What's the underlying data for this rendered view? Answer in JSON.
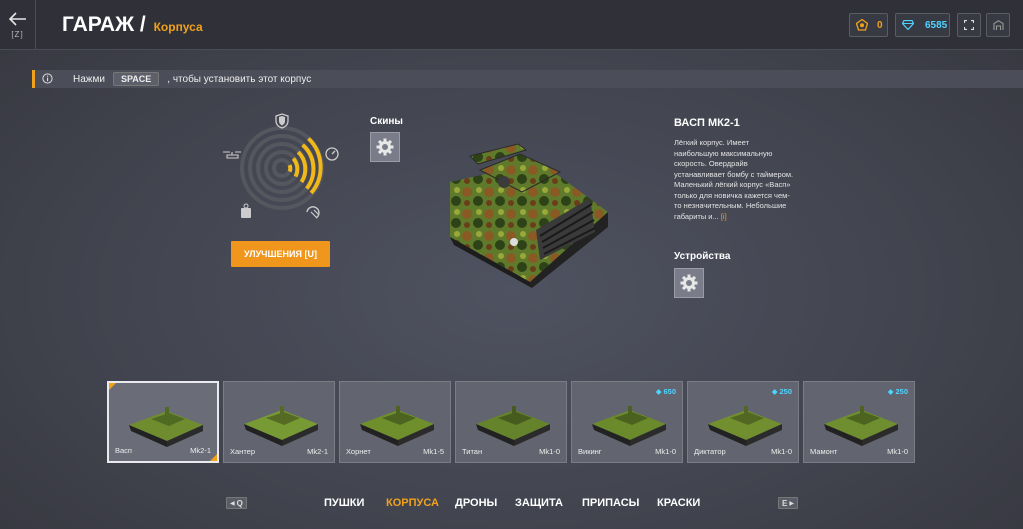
{
  "header": {
    "back_key": "[Z]",
    "title": "ГАРАЖ /",
    "subtitle": "Корпуса",
    "stars": "0",
    "crystals": "6585",
    "colors": {
      "accent": "#f1a21b",
      "crystal": "#4fd4ff"
    }
  },
  "hint": {
    "prefix": "Нажми",
    "key": "SPACE",
    "suffix": ", чтобы установить этот корпус"
  },
  "skins": {
    "label": "Скины"
  },
  "devices": {
    "label": "Устройства"
  },
  "upgrade_button": {
    "label": "УЛУЧШЕНИЯ [U]"
  },
  "hull": {
    "name": "ВАСП МК2-1",
    "description_lines": [
      "Лёгкий корпус. Имеет",
      "наибольшую максимальную",
      "скорость. Овердрайв",
      "устанавливает бомбу с таймером.",
      "Маленький лёгкий корпус «Васп»",
      "только для новичка кажется чем-",
      "то незначительным. Небольшие",
      "габариты и..."
    ],
    "more": "[i]"
  },
  "cards": [
    {
      "name": "Васп",
      "mk": "Mk2-1",
      "price": "",
      "selected": true
    },
    {
      "name": "Хантер",
      "mk": "Mk2-1",
      "price": "",
      "selected": false
    },
    {
      "name": "Хорнет",
      "mk": "Mk1-5",
      "price": "",
      "selected": false
    },
    {
      "name": "Титан",
      "mk": "Mk1-0",
      "price": "",
      "selected": false
    },
    {
      "name": "Викинг",
      "mk": "Mk1-0",
      "price": "650",
      "selected": false
    },
    {
      "name": "Диктатор",
      "mk": "Mk1-0",
      "price": "250",
      "selected": false
    },
    {
      "name": "Мамонт",
      "mk": "Mk1-0",
      "price": "250",
      "selected": false
    }
  ],
  "nav": {
    "prev_key": "Q",
    "next_key": "E",
    "tabs": [
      "ПУШКИ",
      "КОРПУСА",
      "ДРОНЫ",
      "ЗАЩИТА",
      "ПРИПАСЫ",
      "КРАСКИ"
    ],
    "active_index": 1
  }
}
